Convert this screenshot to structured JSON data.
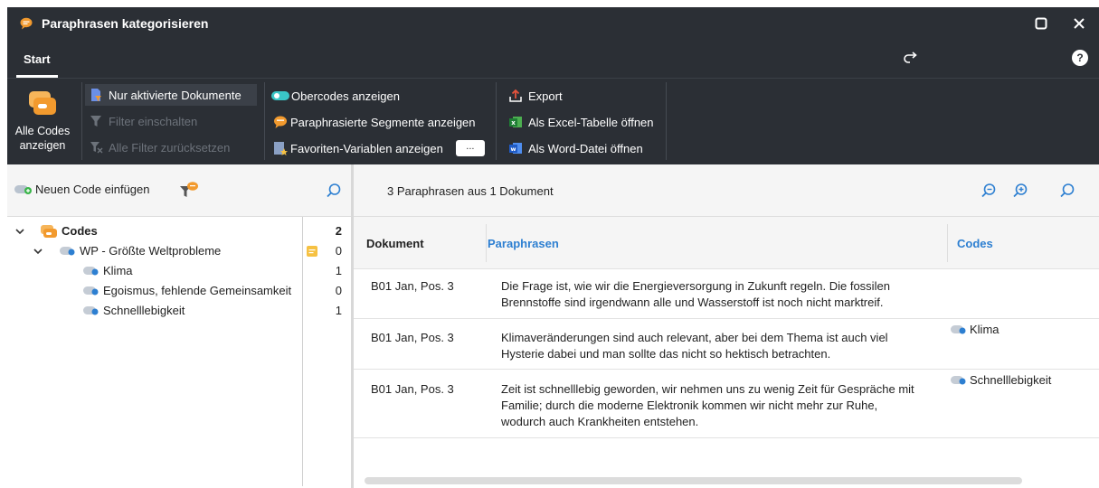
{
  "window": {
    "title": "Paraphrasen kategorisieren"
  },
  "tabs": {
    "start": "Start"
  },
  "ribbon": {
    "all_codes_line1": "Alle Codes",
    "all_codes_line2": "anzeigen",
    "only_active_docs": "Nur aktivierte Dokumente",
    "filter_on": "Filter einschalten",
    "reset_filters": "Alle Filter zurücksetzen",
    "show_parent_codes": "Obercodes anzeigen",
    "show_paraphrased_segments": "Paraphrasierte Segmente anzeigen",
    "show_favorite_variables": "Favoriten-Variablen anzeigen",
    "dots": "...",
    "export": "Export",
    "open_excel": "Als Excel-Tabelle öffnen",
    "open_word": "Als Word-Datei öffnen"
  },
  "left": {
    "new_code": "Neuen Code einfügen",
    "tree": [
      {
        "label": "Codes",
        "count": "2"
      },
      {
        "label": "WP - Größte Weltprobleme",
        "count": "0"
      },
      {
        "label": "Klima",
        "count": "1"
      },
      {
        "label": "Egoismus, fehlende Gemeinsamkeit",
        "count": "0"
      },
      {
        "label": "Schnelllebigkeit",
        "count": "1"
      }
    ]
  },
  "right": {
    "summary": "3 Paraphrasen aus 1 Dokument",
    "columns": {
      "document": "Dokument",
      "paraphrases": "Paraphrasen",
      "codes": "Codes"
    },
    "rows": [
      {
        "document": "B01 Jan, Pos. 3",
        "paraphrase_l1": "Die Frage ist, wie wir die Energieversorgung in Zukunft regeln. Die fossilen",
        "paraphrase_l2": "Brennstoffe sind irgendwann alle und Wasserstoff ist noch nicht marktreif.",
        "code": ""
      },
      {
        "document": "B01 Jan, Pos. 3",
        "paraphrase_l1": "Klimaveränderungen sind auch relevant, aber bei dem Thema ist auch viel",
        "paraphrase_l2": "Hysterie dabei und man sollte das nicht so hektisch betrachten.",
        "code": "Klima"
      },
      {
        "document": "B01 Jan, Pos. 3",
        "paraphrase_l1": "Zeit ist schnelllebig geworden, wir nehmen uns zu wenig Zeit für Gespräche mit",
        "paraphrase_l2": "Familie; durch die moderne Elektronik kommen wir nicht mehr zur Ruhe,",
        "paraphrase_l3": "wodurch auch Krankheiten entstehen.",
        "code": "Schnelllebigkeit"
      }
    ]
  },
  "colors": {
    "chrome": "#2b2f35",
    "accent_blue": "#2d7fd1",
    "orange": "#f29a2e",
    "teal": "#3ac7c7"
  }
}
